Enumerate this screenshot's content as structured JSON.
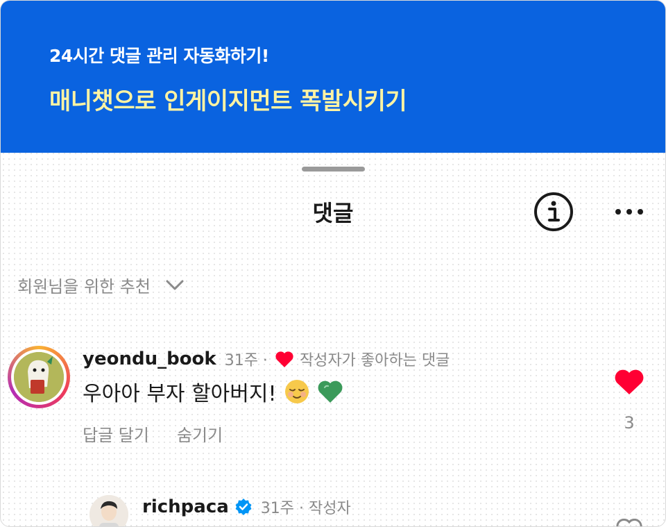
{
  "banner": {
    "subtitle": "24시간 댓글 관리 자동화하기!",
    "title": "매니챗으로 인게이지먼트 폭발시키기"
  },
  "sheet": {
    "title": "댓글",
    "filter_label": "회원님을 위한 추천"
  },
  "comment": {
    "username": "yeondu_book",
    "time": "31주 ·",
    "author_liked": "작성자가 좋아하는 댓글",
    "text": "우아아 부자 할아버지!",
    "emojis": [
      "relieved-face",
      "green-heart"
    ],
    "reply_label": "답글 달기",
    "hide_label": "숨기기",
    "like_count": "3"
  },
  "reply": {
    "username": "richpaca",
    "meta": "31주 · 작성자"
  },
  "colors": {
    "banner_bg": "#0a63e0",
    "banner_title": "#fff3a3",
    "heart": "#ff0033",
    "verified": "#0095f6"
  },
  "icons": {
    "info": "info-icon",
    "more": "more-icon",
    "chevron": "chevron-down-icon",
    "heart": "heart-icon",
    "verified": "verified-badge-icon"
  }
}
